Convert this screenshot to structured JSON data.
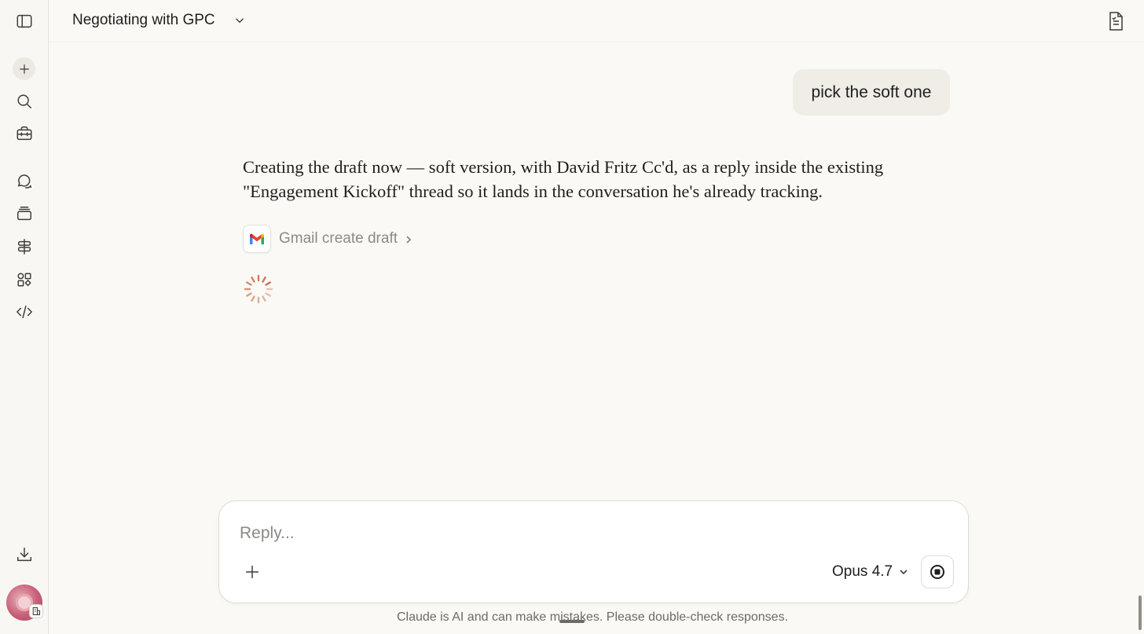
{
  "header": {
    "title": "Negotiating with GPC"
  },
  "sidebar": {
    "items": [
      {
        "name": "toggle-sidebar",
        "icon": "sidebar-icon"
      },
      {
        "name": "new-chat",
        "icon": "plus-icon"
      },
      {
        "name": "search",
        "icon": "search-icon"
      },
      {
        "name": "tools",
        "icon": "toolbox-icon"
      },
      {
        "name": "chats",
        "icon": "chat-bubbles-icon"
      },
      {
        "name": "projects",
        "icon": "stack-icon"
      },
      {
        "name": "signposts",
        "icon": "signpost-icon"
      },
      {
        "name": "artifacts",
        "icon": "shapes-icon"
      },
      {
        "name": "code",
        "icon": "code-icon"
      },
      {
        "name": "download",
        "icon": "download-icon"
      }
    ]
  },
  "conversation": {
    "user_message": "pick the soft one",
    "assistant_message": "Creating the draft now — soft version, with David Fritz Cc'd, as a reply inside the existing \"Engagement Kickoff\" thread so it lands in the conversation he's already tracking.",
    "tool_call": {
      "label": "Gmail create draft",
      "icon": "gmail-icon"
    }
  },
  "composer": {
    "placeholder": "Reply...",
    "value": "",
    "model": "Opus 4.7"
  },
  "footer": {
    "disclaimer": "Claude is AI and can make mistakes. Please double-check responses."
  },
  "colors": {
    "background": "#faf9f5",
    "accent": "#c96442",
    "bubble": "#efede6"
  }
}
